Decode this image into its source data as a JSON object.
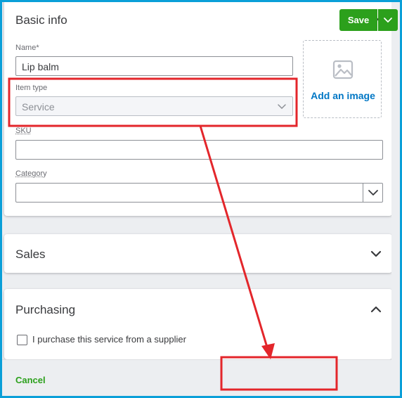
{
  "basic_info": {
    "title": "Basic info",
    "name_label": "Name*",
    "name_value": "Lip balm",
    "item_type_label": "Item type",
    "item_type_value": "Service",
    "sku_label": "SKU",
    "sku_value": "",
    "category_label": "Category",
    "category_value": "",
    "add_image_label": "Add an image"
  },
  "sales": {
    "title": "Sales"
  },
  "purchasing": {
    "title": "Purchasing",
    "supplier_checkbox_label": "I purchase this service from a supplier",
    "supplier_checked": false
  },
  "footer": {
    "cancel_label": "Cancel",
    "save_label": "Save"
  },
  "colors": {
    "accent_green": "#2ca01c",
    "link_blue": "#0077c5",
    "frame_blue": "#0a9fd8",
    "annotation_red": "#e3262b"
  }
}
